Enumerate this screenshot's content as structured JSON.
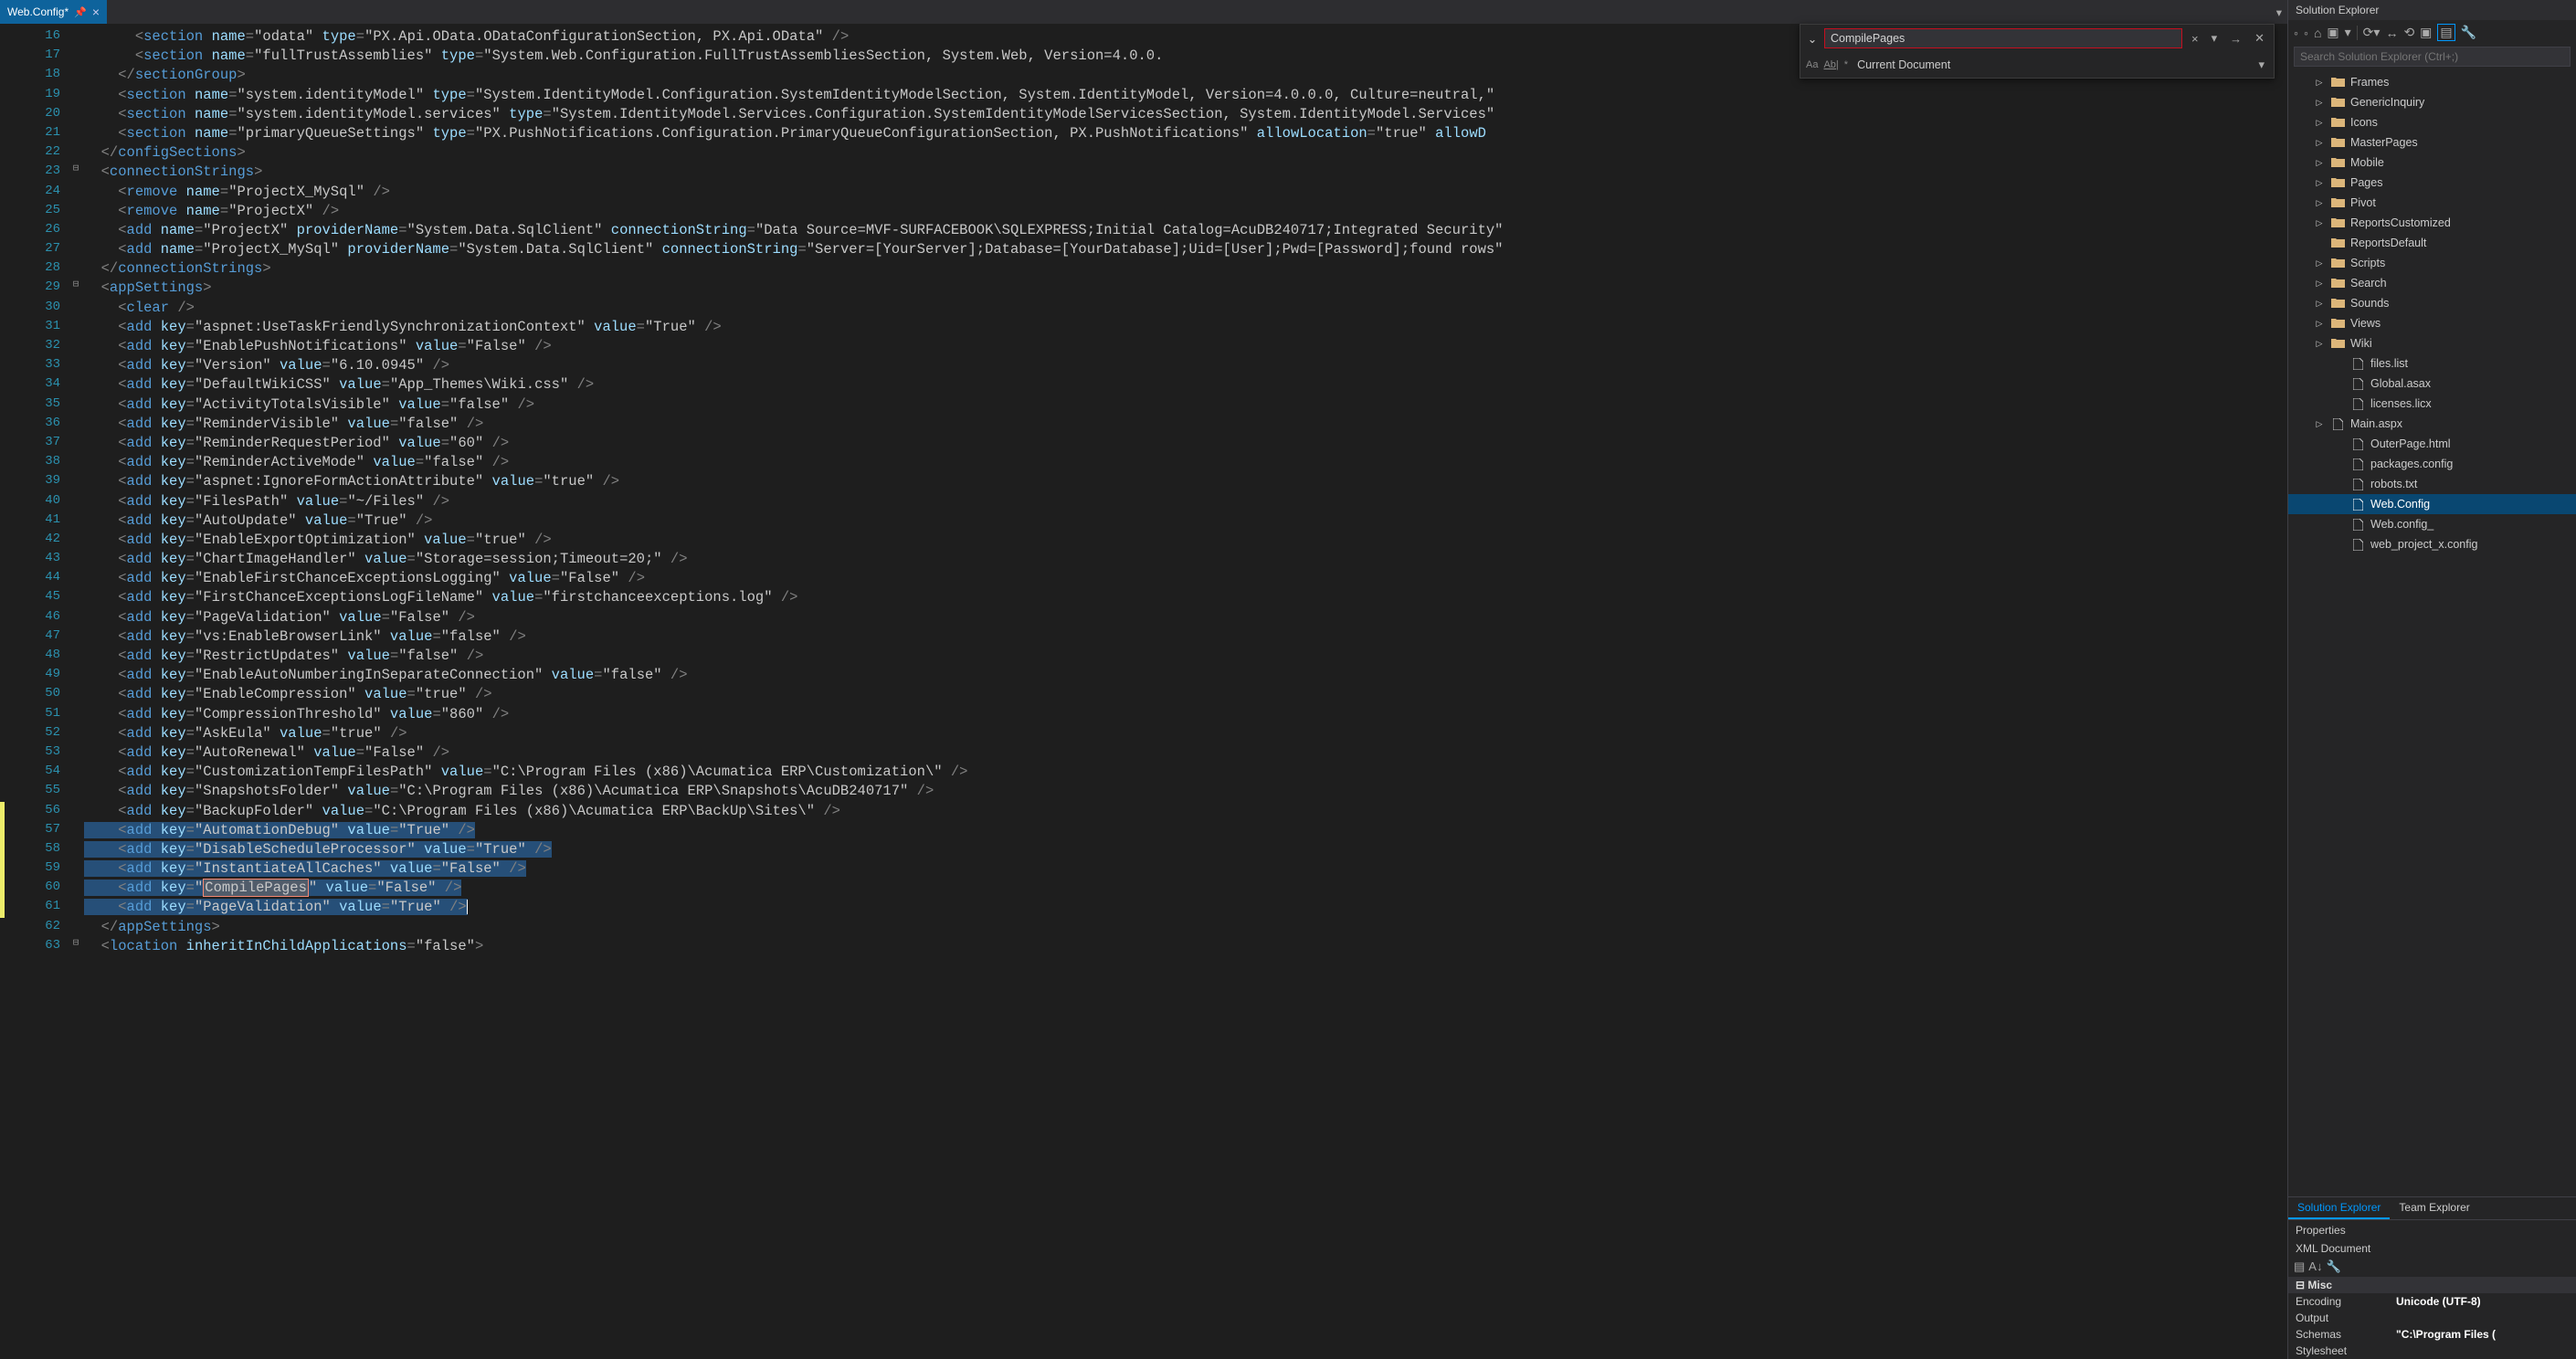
{
  "tab": {
    "title": "Web.Config*",
    "modified": true
  },
  "find": {
    "query": "CompilePages",
    "scope_label": "Current Document",
    "options": [
      "Aa",
      "Ab|",
      "*"
    ],
    "no_results_border": "#c50f1f"
  },
  "code_lines": [
    {
      "n": 16,
      "i": 3,
      "html": "<span class='p'>&lt;</span><span class='t'>section</span> <span class='a'>name</span><span class='eq'>=</span><span class='s'>\"odata\"</span> <span class='a'>type</span><span class='eq'>=</span><span class='s'>\"PX.Api.OData.ODataConfigurationSection, PX.Api.OData\"</span> <span class='p'>/&gt;</span>"
    },
    {
      "n": 17,
      "i": 3,
      "html": "<span class='p'>&lt;</span><span class='t'>section</span> <span class='a'>name</span><span class='eq'>=</span><span class='s'>\"fullTrustAssemblies\"</span> <span class='a'>type</span><span class='eq'>=</span><span class='s'>\"System.Web.Configuration.FullTrustAssembliesSection, System.Web, Version=4.0.0.</span>"
    },
    {
      "n": 18,
      "i": 2,
      "html": "<span class='p'>&lt;/</span><span class='t'>sectionGroup</span><span class='p'>&gt;</span>"
    },
    {
      "n": 19,
      "i": 2,
      "html": "<span class='p'>&lt;</span><span class='t'>section</span> <span class='a'>name</span><span class='eq'>=</span><span class='s'>\"system.identityModel\"</span> <span class='a'>type</span><span class='eq'>=</span><span class='s'>\"System.IdentityModel.Configuration.SystemIdentityModelSection, System.IdentityModel, Version=4.0.0.0, Culture=neutral,\"</span>"
    },
    {
      "n": 20,
      "i": 2,
      "html": "<span class='p'>&lt;</span><span class='t'>section</span> <span class='a'>name</span><span class='eq'>=</span><span class='s'>\"system.identityModel.services\"</span> <span class='a'>type</span><span class='eq'>=</span><span class='s'>\"System.IdentityModel.Services.Configuration.SystemIdentityModelServicesSection, System.IdentityModel.Services\"</span>"
    },
    {
      "n": 21,
      "i": 2,
      "html": "<span class='p'>&lt;</span><span class='t'>section</span> <span class='a'>name</span><span class='eq'>=</span><span class='s'>\"primaryQueueSettings\"</span> <span class='a'>type</span><span class='eq'>=</span><span class='s'>\"PX.PushNotifications.Configuration.PrimaryQueueConfigurationSection, PX.PushNotifications\"</span> <span class='a'>allowLocation</span><span class='eq'>=</span><span class='s'>\"true\"</span> <span class='a'>allowD</span>"
    },
    {
      "n": 22,
      "i": 1,
      "html": "<span class='p'>&lt;/</span><span class='t'>configSections</span><span class='p'>&gt;</span>"
    },
    {
      "n": 23,
      "i": 1,
      "out": "⊟",
      "html": "<span class='p'>&lt;</span><span class='t'>connectionStrings</span><span class='p'>&gt;</span>"
    },
    {
      "n": 24,
      "i": 2,
      "html": "<span class='p'>&lt;</span><span class='t'>remove</span> <span class='a'>name</span><span class='eq'>=</span><span class='s'>\"ProjectX_MySql\"</span> <span class='p'>/&gt;</span>"
    },
    {
      "n": 25,
      "i": 2,
      "html": "<span class='p'>&lt;</span><span class='t'>remove</span> <span class='a'>name</span><span class='eq'>=</span><span class='s'>\"ProjectX\"</span> <span class='p'>/&gt;</span>"
    },
    {
      "n": 26,
      "i": 2,
      "html": "<span class='p'>&lt;</span><span class='t'>add</span> <span class='a'>name</span><span class='eq'>=</span><span class='s'>\"ProjectX\"</span> <span class='a'>providerName</span><span class='eq'>=</span><span class='s'>\"System.Data.SqlClient\"</span> <span class='a'>connectionString</span><span class='eq'>=</span><span class='s'>\"Data Source=MVF-SURFACEBOOK\\SQLEXPRESS;Initial Catalog=AcuDB240717;Integrated Security\"</span>"
    },
    {
      "n": 27,
      "i": 2,
      "html": "<span class='p'>&lt;</span><span class='t'>add</span> <span class='a'>name</span><span class='eq'>=</span><span class='s'>\"ProjectX_MySql\"</span> <span class='a'>providerName</span><span class='eq'>=</span><span class='s'>\"System.Data.SqlClient\"</span> <span class='a'>connectionString</span><span class='eq'>=</span><span class='s'>\"Server=[YourServer];Database=[YourDatabase];Uid=[User];Pwd=[Password];found rows\"</span>"
    },
    {
      "n": 28,
      "i": 1,
      "html": "<span class='p'>&lt;/</span><span class='t'>connectionStrings</span><span class='p'>&gt;</span>"
    },
    {
      "n": 29,
      "i": 1,
      "out": "⊟",
      "html": "<span class='p'>&lt;</span><span class='t'>appSettings</span><span class='p'>&gt;</span>"
    },
    {
      "n": 30,
      "i": 2,
      "html": "<span class='p'>&lt;</span><span class='t'>clear</span> <span class='p'>/&gt;</span>"
    },
    {
      "n": 31,
      "i": 2,
      "html": "<span class='p'>&lt;</span><span class='t'>add</span> <span class='a'>key</span><span class='eq'>=</span><span class='s'>\"aspnet:UseTaskFriendlySynchronizationContext\"</span> <span class='a'>value</span><span class='eq'>=</span><span class='s'>\"True\"</span> <span class='p'>/&gt;</span>"
    },
    {
      "n": 32,
      "i": 2,
      "html": "<span class='p'>&lt;</span><span class='t'>add</span> <span class='a'>key</span><span class='eq'>=</span><span class='s'>\"EnablePushNotifications\"</span> <span class='a'>value</span><span class='eq'>=</span><span class='s'>\"False\"</span> <span class='p'>/&gt;</span>"
    },
    {
      "n": 33,
      "i": 2,
      "html": "<span class='p'>&lt;</span><span class='t'>add</span> <span class='a'>key</span><span class='eq'>=</span><span class='s'>\"Version\"</span> <span class='a'>value</span><span class='eq'>=</span><span class='s'>\"6.10.0945\"</span> <span class='p'>/&gt;</span>"
    },
    {
      "n": 34,
      "i": 2,
      "html": "<span class='p'>&lt;</span><span class='t'>add</span> <span class='a'>key</span><span class='eq'>=</span><span class='s'>\"DefaultWikiCSS\"</span> <span class='a'>value</span><span class='eq'>=</span><span class='s'>\"App_Themes\\Wiki.css\"</span> <span class='p'>/&gt;</span>"
    },
    {
      "n": 35,
      "i": 2,
      "html": "<span class='p'>&lt;</span><span class='t'>add</span> <span class='a'>key</span><span class='eq'>=</span><span class='s'>\"ActivityTotalsVisible\"</span> <span class='a'>value</span><span class='eq'>=</span><span class='s'>\"false\"</span> <span class='p'>/&gt;</span>"
    },
    {
      "n": 36,
      "i": 2,
      "html": "<span class='p'>&lt;</span><span class='t'>add</span> <span class='a'>key</span><span class='eq'>=</span><span class='s'>\"ReminderVisible\"</span> <span class='a'>value</span><span class='eq'>=</span><span class='s'>\"false\"</span> <span class='p'>/&gt;</span>"
    },
    {
      "n": 37,
      "i": 2,
      "html": "<span class='p'>&lt;</span><span class='t'>add</span> <span class='a'>key</span><span class='eq'>=</span><span class='s'>\"ReminderRequestPeriod\"</span> <span class='a'>value</span><span class='eq'>=</span><span class='s'>\"60\"</span> <span class='p'>/&gt;</span>"
    },
    {
      "n": 38,
      "i": 2,
      "html": "<span class='p'>&lt;</span><span class='t'>add</span> <span class='a'>key</span><span class='eq'>=</span><span class='s'>\"ReminderActiveMode\"</span> <span class='a'>value</span><span class='eq'>=</span><span class='s'>\"false\"</span> <span class='p'>/&gt;</span>"
    },
    {
      "n": 39,
      "i": 2,
      "html": "<span class='p'>&lt;</span><span class='t'>add</span> <span class='a'>key</span><span class='eq'>=</span><span class='s'>\"aspnet:IgnoreFormActionAttribute\"</span> <span class='a'>value</span><span class='eq'>=</span><span class='s'>\"true\"</span> <span class='p'>/&gt;</span>"
    },
    {
      "n": 40,
      "i": 2,
      "html": "<span class='p'>&lt;</span><span class='t'>add</span> <span class='a'>key</span><span class='eq'>=</span><span class='s'>\"FilesPath\"</span> <span class='a'>value</span><span class='eq'>=</span><span class='s'>\"~/Files\"</span> <span class='p'>/&gt;</span>"
    },
    {
      "n": 41,
      "i": 2,
      "html": "<span class='p'>&lt;</span><span class='t'>add</span> <span class='a'>key</span><span class='eq'>=</span><span class='s'>\"AutoUpdate\"</span> <span class='a'>value</span><span class='eq'>=</span><span class='s'>\"True\"</span> <span class='p'>/&gt;</span>"
    },
    {
      "n": 42,
      "i": 2,
      "html": "<span class='p'>&lt;</span><span class='t'>add</span> <span class='a'>key</span><span class='eq'>=</span><span class='s'>\"EnableExportOptimization\"</span> <span class='a'>value</span><span class='eq'>=</span><span class='s'>\"true\"</span> <span class='p'>/&gt;</span>"
    },
    {
      "n": 43,
      "i": 2,
      "html": "<span class='p'>&lt;</span><span class='t'>add</span> <span class='a'>key</span><span class='eq'>=</span><span class='s'>\"ChartImageHandler\"</span> <span class='a'>value</span><span class='eq'>=</span><span class='s'>\"Storage=session;Timeout=20;\"</span> <span class='p'>/&gt;</span>"
    },
    {
      "n": 44,
      "i": 2,
      "html": "<span class='p'>&lt;</span><span class='t'>add</span> <span class='a'>key</span><span class='eq'>=</span><span class='s'>\"EnableFirstChanceExceptionsLogging\"</span> <span class='a'>value</span><span class='eq'>=</span><span class='s'>\"False\"</span> <span class='p'>/&gt;</span>"
    },
    {
      "n": 45,
      "i": 2,
      "html": "<span class='p'>&lt;</span><span class='t'>add</span> <span class='a'>key</span><span class='eq'>=</span><span class='s'>\"FirstChanceExceptionsLogFileName\"</span> <span class='a'>value</span><span class='eq'>=</span><span class='s'>\"firstchanceexceptions.log\"</span> <span class='p'>/&gt;</span>"
    },
    {
      "n": 46,
      "i": 2,
      "html": "<span class='p'>&lt;</span><span class='t'>add</span> <span class='a'>key</span><span class='eq'>=</span><span class='s'>\"PageValidation\"</span> <span class='a'>value</span><span class='eq'>=</span><span class='s'>\"False\"</span> <span class='p'>/&gt;</span>"
    },
    {
      "n": 47,
      "i": 2,
      "html": "<span class='p'>&lt;</span><span class='t'>add</span> <span class='a'>key</span><span class='eq'>=</span><span class='s'>\"vs:EnableBrowserLink\"</span> <span class='a'>value</span><span class='eq'>=</span><span class='s'>\"false\"</span> <span class='p'>/&gt;</span>"
    },
    {
      "n": 48,
      "i": 2,
      "html": "<span class='p'>&lt;</span><span class='t'>add</span> <span class='a'>key</span><span class='eq'>=</span><span class='s'>\"RestrictUpdates\"</span> <span class='a'>value</span><span class='eq'>=</span><span class='s'>\"false\"</span> <span class='p'>/&gt;</span>"
    },
    {
      "n": 49,
      "i": 2,
      "html": "<span class='p'>&lt;</span><span class='t'>add</span> <span class='a'>key</span><span class='eq'>=</span><span class='s'>\"EnableAutoNumberingInSeparateConnection\"</span> <span class='a'>value</span><span class='eq'>=</span><span class='s'>\"false\"</span> <span class='p'>/&gt;</span>"
    },
    {
      "n": 50,
      "i": 2,
      "html": "<span class='p'>&lt;</span><span class='t'>add</span> <span class='a'>key</span><span class='eq'>=</span><span class='s'>\"EnableCompression\"</span> <span class='a'>value</span><span class='eq'>=</span><span class='s'>\"true\"</span> <span class='p'>/&gt;</span>"
    },
    {
      "n": 51,
      "i": 2,
      "html": "<span class='p'>&lt;</span><span class='t'>add</span> <span class='a'>key</span><span class='eq'>=</span><span class='s'>\"CompressionThreshold\"</span> <span class='a'>value</span><span class='eq'>=</span><span class='s'>\"860\"</span> <span class='p'>/&gt;</span>"
    },
    {
      "n": 52,
      "i": 2,
      "html": "<span class='p'>&lt;</span><span class='t'>add</span> <span class='a'>key</span><span class='eq'>=</span><span class='s'>\"AskEula\"</span> <span class='a'>value</span><span class='eq'>=</span><span class='s'>\"true\"</span> <span class='p'>/&gt;</span>"
    },
    {
      "n": 53,
      "i": 2,
      "html": "<span class='p'>&lt;</span><span class='t'>add</span> <span class='a'>key</span><span class='eq'>=</span><span class='s'>\"AutoRenewal\"</span> <span class='a'>value</span><span class='eq'>=</span><span class='s'>\"False\"</span> <span class='p'>/&gt;</span>"
    },
    {
      "n": 54,
      "i": 2,
      "html": "<span class='p'>&lt;</span><span class='t'>add</span> <span class='a'>key</span><span class='eq'>=</span><span class='s'>\"CustomizationTempFilesPath\"</span> <span class='a'>value</span><span class='eq'>=</span><span class='s'>\"C:\\Program Files (x86)\\Acumatica ERP\\Customization\\\"</span> <span class='p'>/&gt;</span>"
    },
    {
      "n": 55,
      "i": 2,
      "html": "<span class='p'>&lt;</span><span class='t'>add</span> <span class='a'>key</span><span class='eq'>=</span><span class='s'>\"SnapshotsFolder\"</span> <span class='a'>value</span><span class='eq'>=</span><span class='s'>\"C:\\Program Files (x86)\\Acumatica ERP\\Snapshots\\AcuDB240717\"</span> <span class='p'>/&gt;</span>"
    },
    {
      "n": 56,
      "i": 2,
      "mark": "y",
      "html": "<span class='p'>&lt;</span><span class='t'>add</span> <span class='a'>key</span><span class='eq'>=</span><span class='s'>\"BackupFolder\"</span> <span class='a'>value</span><span class='eq'>=</span><span class='s'>\"C:\\Program Files (x86)\\Acumatica ERP\\BackUp\\Sites\\\"</span> <span class='p'>/&gt;</span>"
    },
    {
      "n": 57,
      "i": 2,
      "sel": true,
      "mark": "y",
      "html": "<span class='p'>&lt;</span><span class='t'>add</span> <span class='a'>key</span><span class='eq'>=</span><span class='s'>\"AutomationDebug\"</span> <span class='a'>value</span><span class='eq'>=</span><span class='s'>\"True\"</span> <span class='p'>/&gt;</span>"
    },
    {
      "n": 58,
      "i": 2,
      "sel": true,
      "mark": "y",
      "html": "<span class='p'>&lt;</span><span class='t'>add</span> <span class='a'>key</span><span class='eq'>=</span><span class='s'>\"DisableScheduleProcessor\"</span> <span class='a'>value</span><span class='eq'>=</span><span class='s'>\"True\"</span> <span class='p'>/&gt;</span>"
    },
    {
      "n": 59,
      "i": 2,
      "sel": true,
      "mark": "y",
      "html": "<span class='p'>&lt;</span><span class='t'>add</span> <span class='a'>key</span><span class='eq'>=</span><span class='s'>\"InstantiateAllCaches\"</span> <span class='a'>value</span><span class='eq'>=</span><span class='s'>\"False\"</span> <span class='p'>/&gt;</span>"
    },
    {
      "n": 60,
      "i": 2,
      "sel": true,
      "mark": "y",
      "html": "<span class='p'>&lt;</span><span class='t'>add</span> <span class='a'>key</span><span class='eq'>=</span><span class='s'>\"<span class='hl-search'>CompilePages</span>\"</span> <span class='a'>value</span><span class='eq'>=</span><span class='s'>\"False\"</span> <span class='p'>/&gt;</span>"
    },
    {
      "n": 61,
      "i": 2,
      "sel": true,
      "mark": "y",
      "caret": true,
      "html": "<span class='p'>&lt;</span><span class='t'>add</span> <span class='a'>key</span><span class='eq'>=</span><span class='s'>\"PageValidation\"</span> <span class='a'>value</span><span class='eq'>=</span><span class='s'>\"True\"</span> <span class='p'>/&gt;</span>"
    },
    {
      "n": 62,
      "i": 1,
      "html": "<span class='p'>&lt;/</span><span class='t'>appSettings</span><span class='p'>&gt;</span>"
    },
    {
      "n": 63,
      "i": 1,
      "out": "⊟",
      "html": "<span class='p'>&lt;</span><span class='t'>location</span> <span class='a'>inheritInChildApplications</span><span class='eq'>=</span><span class='s'>\"false\"</span><span class='p'>&gt;</span>"
    }
  ],
  "solution_explorer": {
    "title": "Solution Explorer",
    "search_placeholder": "Search Solution Explorer (Ctrl+;)",
    "tabs": {
      "active": "Solution Explorer",
      "other": "Team Explorer"
    },
    "items": [
      {
        "depth": 1,
        "type": "folder",
        "expand": "▷",
        "label": "Frames"
      },
      {
        "depth": 1,
        "type": "folder",
        "expand": "▷",
        "label": "GenericInquiry"
      },
      {
        "depth": 1,
        "type": "folder",
        "expand": "▷",
        "label": "Icons"
      },
      {
        "depth": 1,
        "type": "folder",
        "expand": "▷",
        "label": "MasterPages"
      },
      {
        "depth": 1,
        "type": "folder",
        "expand": "▷",
        "label": "Mobile"
      },
      {
        "depth": 1,
        "type": "folder",
        "expand": "▷",
        "label": "Pages"
      },
      {
        "depth": 1,
        "type": "folder",
        "expand": "▷",
        "label": "Pivot"
      },
      {
        "depth": 1,
        "type": "folder",
        "expand": "▷",
        "label": "ReportsCustomized"
      },
      {
        "depth": 1,
        "type": "folder",
        "expand": "",
        "label": "ReportsDefault"
      },
      {
        "depth": 1,
        "type": "folder",
        "expand": "▷",
        "label": "Scripts"
      },
      {
        "depth": 1,
        "type": "folder",
        "expand": "▷",
        "label": "Search"
      },
      {
        "depth": 1,
        "type": "folder",
        "expand": "▷",
        "label": "Sounds"
      },
      {
        "depth": 1,
        "type": "folder",
        "expand": "▷",
        "label": "Views"
      },
      {
        "depth": 1,
        "type": "folder",
        "expand": "▷",
        "label": "Wiki"
      },
      {
        "depth": 2,
        "type": "file",
        "expand": "",
        "label": "files.list"
      },
      {
        "depth": 2,
        "type": "file",
        "expand": "",
        "label": "Global.asax"
      },
      {
        "depth": 2,
        "type": "file",
        "expand": "",
        "label": "licenses.licx"
      },
      {
        "depth": 1,
        "type": "aspx",
        "expand": "▷",
        "label": "Main.aspx"
      },
      {
        "depth": 2,
        "type": "config",
        "expand": "",
        "label": "OuterPage.html"
      },
      {
        "depth": 2,
        "type": "config",
        "expand": "",
        "label": "packages.config"
      },
      {
        "depth": 2,
        "type": "file",
        "expand": "",
        "label": "robots.txt"
      },
      {
        "depth": 2,
        "type": "config",
        "expand": "",
        "label": "Web.Config",
        "selected": true
      },
      {
        "depth": 2,
        "type": "file",
        "expand": "",
        "label": "Web.config_"
      },
      {
        "depth": 2,
        "type": "config",
        "expand": "",
        "label": "web_project_x.config"
      }
    ]
  },
  "properties": {
    "title": "Properties",
    "subtitle": "XML Document",
    "category": "Misc",
    "rows": [
      {
        "k": "Encoding",
        "v": "Unicode (UTF-8)"
      },
      {
        "k": "Output",
        "v": ""
      },
      {
        "k": "Schemas",
        "v": "\"C:\\Program Files ("
      },
      {
        "k": "Stylesheet",
        "v": ""
      }
    ]
  }
}
